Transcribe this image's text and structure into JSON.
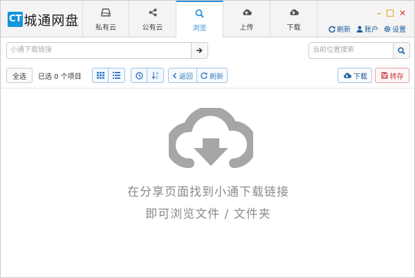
{
  "app": {
    "logo_badge": "CT",
    "logo_text": "城通网盘"
  },
  "tabs": [
    {
      "label": "私有云",
      "icon": "drive-icon"
    },
    {
      "label": "公有云",
      "icon": "share-icon"
    },
    {
      "label": "浏览",
      "icon": "search-icon",
      "active": true
    },
    {
      "label": "上传",
      "icon": "cloud-upload-icon"
    },
    {
      "label": "下载",
      "icon": "cloud-download-icon"
    }
  ],
  "actions": {
    "refresh": "刷新",
    "account": "账户",
    "settings": "设置"
  },
  "linkbar": {
    "placeholder": "小通下载链接",
    "search_placeholder": "当前位置搜索"
  },
  "toolbar": {
    "select_all": "全选",
    "selected_count": "已选 0 个项目",
    "back": "返回",
    "refresh": "刷新",
    "download": "下载",
    "save": "转存"
  },
  "empty": {
    "line1": "在分享页面找到小通下载链接",
    "line2": "即可浏览文件 / 文件夹"
  },
  "colors": {
    "accent": "#2a8fd8",
    "logo": "#1296db",
    "minimize": "#f0a020",
    "close": "#e0352b",
    "save": "#c43b3b",
    "empty_icon": "#a6a6a6"
  }
}
